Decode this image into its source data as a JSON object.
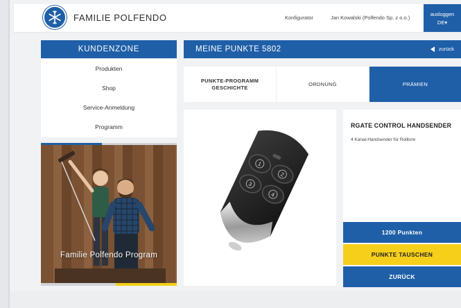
{
  "header": {
    "brand": "FAMILIE POLFENDO",
    "logo_icon": "snowflake-logo",
    "nav": {
      "konfigurator": "Konfigurator",
      "user": "Jan Kowalski (Polfendo Sp. z o.o.)"
    },
    "logout": "ausloggen",
    "language": "DE▾"
  },
  "sidebar": {
    "title": "KUNDENZONE",
    "items": [
      {
        "label": "Produkten"
      },
      {
        "label": "Shop"
      },
      {
        "label": "Service-Anmeldung"
      },
      {
        "label": "Programm"
      }
    ],
    "promo_caption": "Familie Polfendo Program"
  },
  "points": {
    "title": "MEINE PUNKTE 5802",
    "back": "zurück"
  },
  "tabs": [
    {
      "label": "PUNKTE-PROGRAMM GESCHICHTE"
    },
    {
      "label": "ORDNUNG"
    },
    {
      "label": "PRÄMIEN"
    }
  ],
  "product": {
    "title": "RGATE CONTROL HANDSENDER",
    "description": "4 Kanal-Handsender für Rolltore",
    "price_label": "1200 Punkten",
    "exchange_button": "PUNKTE TAUSCHEN",
    "back_button": "ZURÜCK",
    "remote_buttons": [
      "1",
      "2",
      "3",
      "4"
    ]
  },
  "colors": {
    "brand_blue": "#1f5fa8",
    "accent_yellow": "#f5cf1a"
  }
}
